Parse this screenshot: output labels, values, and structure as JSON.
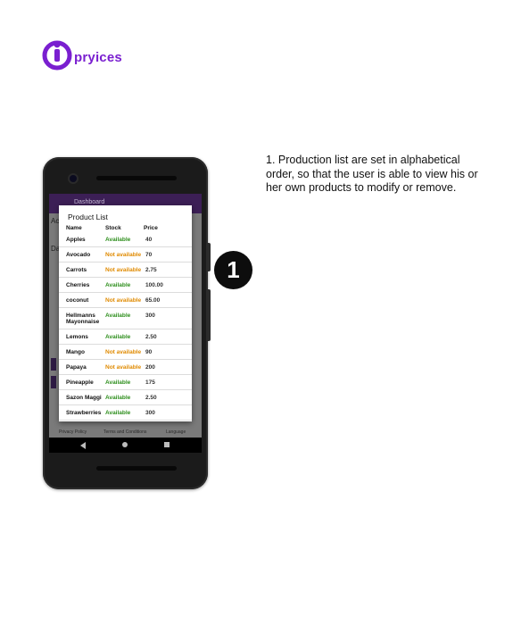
{
  "brand": {
    "name": "pryices",
    "color": "#7a1fd0"
  },
  "description": "1. Production list are set in alphabetical order, so that the user is able to view his or her own products to modify or remove.",
  "step": {
    "number": "1"
  },
  "phone": {
    "app_bar_title": "Dashboard",
    "behind_labels": [
      "Ac",
      "Da"
    ],
    "footer_links": [
      "Privacy Policy",
      "Terms and Conditions",
      "Language"
    ],
    "dialog": {
      "title": "Product List",
      "columns": [
        "Name",
        "Stock",
        "Price"
      ],
      "rows": [
        {
          "name": "Apples",
          "stock": "Available",
          "price": "40"
        },
        {
          "name": "Avocado",
          "stock": "Not available",
          "price": "70"
        },
        {
          "name": "Carrots",
          "stock": "Not available",
          "price": "2.75"
        },
        {
          "name": "Cherries",
          "stock": "Available",
          "price": "100.00"
        },
        {
          "name": "coconut",
          "stock": "Not available",
          "price": "65.00"
        },
        {
          "name": "Hellmanns Mayonnaise",
          "stock": "Available",
          "price": "300"
        },
        {
          "name": "Lemons",
          "stock": "Available",
          "price": "2.50"
        },
        {
          "name": "Mango",
          "stock": "Not available",
          "price": "90"
        },
        {
          "name": "Papaya",
          "stock": "Not available",
          "price": "200"
        },
        {
          "name": "Pineapple",
          "stock": "Available",
          "price": "175"
        },
        {
          "name": "Sazon Maggi",
          "stock": "Available",
          "price": "2.50"
        },
        {
          "name": "Strawberries",
          "stock": "Available",
          "price": "300"
        }
      ]
    },
    "colors": {
      "available": "#2f8f1e",
      "not_available": "#e08a00",
      "app_bar": "#3c1f56"
    }
  }
}
